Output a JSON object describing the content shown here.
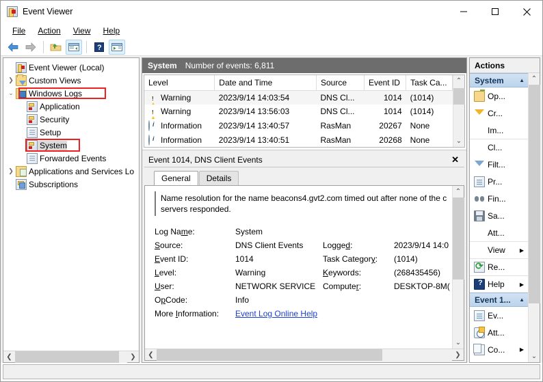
{
  "window": {
    "title": "Event Viewer",
    "icon": "event-viewer-icon",
    "minimize": "−",
    "maximize": "□",
    "close": "✕"
  },
  "menu": {
    "items": [
      {
        "label": "File",
        "accel": "F"
      },
      {
        "label": "Action",
        "accel": "A"
      },
      {
        "label": "View",
        "accel": "V"
      },
      {
        "label": "Help",
        "accel": "H"
      }
    ]
  },
  "toolbar": {
    "buttons": [
      {
        "name": "back-icon",
        "active": false
      },
      {
        "name": "forward-icon",
        "active": false
      },
      {
        "name": "show-hide-tree-icon",
        "active": false
      },
      {
        "name": "show-hide-console-tree-icon",
        "active": true
      },
      {
        "name": "help-icon",
        "active": false
      },
      {
        "name": "show-hide-action-pane-icon",
        "active": true
      }
    ]
  },
  "tree": {
    "nodes": [
      {
        "label": "Event Viewer (Local)",
        "icon": "event-viewer-icon",
        "indent": 0,
        "twist": "",
        "selected": false,
        "highlight": false
      },
      {
        "label": "Custom Views",
        "icon": "custom-views-folder-icon",
        "indent": 0,
        "twist": "collapsed",
        "selected": false,
        "highlight": false
      },
      {
        "label": "Windows Logs",
        "icon": "windows-logs-folder-icon",
        "indent": 0,
        "twist": "expanded",
        "selected": false,
        "highlight": true
      },
      {
        "label": "Application",
        "icon": "log-icon",
        "indent": 1,
        "twist": "",
        "selected": false,
        "highlight": false
      },
      {
        "label": "Security",
        "icon": "log-icon",
        "indent": 1,
        "twist": "",
        "selected": false,
        "highlight": false
      },
      {
        "label": "Setup",
        "icon": "plain-log-icon",
        "indent": 1,
        "twist": "",
        "selected": false,
        "highlight": false
      },
      {
        "label": "System",
        "icon": "log-icon",
        "indent": 1,
        "twist": "",
        "selected": true,
        "highlight": true
      },
      {
        "label": "Forwarded Events",
        "icon": "plain-log-icon",
        "indent": 1,
        "twist": "",
        "selected": false,
        "highlight": false
      },
      {
        "label": "Applications and Services Lo",
        "icon": "apps-services-folder-icon",
        "indent": 0,
        "twist": "collapsed",
        "selected": false,
        "highlight": false
      },
      {
        "label": "Subscriptions",
        "icon": "subscriptions-icon",
        "indent": 0,
        "twist": "",
        "selected": false,
        "highlight": false
      }
    ]
  },
  "center": {
    "header": {
      "log_name": "System",
      "count_text": "Number of events: 6,811"
    },
    "list": {
      "columns": [
        "Level",
        "Date and Time",
        "Source",
        "Event ID",
        "Task Ca..."
      ],
      "rows": [
        {
          "level": "Warning",
          "level_icon": "warning-icon",
          "datetime": "2023/9/14 14:03:54",
          "source": "DNS Cl...",
          "event_id": "1014",
          "task": "(1014)"
        },
        {
          "level": "Warning",
          "level_icon": "warning-icon",
          "datetime": "2023/9/14 13:56:03",
          "source": "DNS Cl...",
          "event_id": "1014",
          "task": "(1014)"
        },
        {
          "level": "Information",
          "level_icon": "information-icon",
          "datetime": "2023/9/14 13:40:57",
          "source": "RasMan",
          "event_id": "20267",
          "task": "None"
        },
        {
          "level": "Information",
          "level_icon": "information-icon",
          "datetime": "2023/9/14 13:40:51",
          "source": "RasMan",
          "event_id": "20268",
          "task": "None"
        }
      ]
    },
    "details": {
      "header": "Event 1014, DNS Client Events",
      "close_label": "✕",
      "tabs": [
        {
          "label": "General",
          "selected": true
        },
        {
          "label": "Details",
          "selected": false
        }
      ],
      "message": "Name resolution for the name beacons4.gvt2.com timed out after none of the c servers responded.",
      "fields": [
        {
          "label": "Log Name:",
          "accel": "m",
          "value": "System",
          "label2": "",
          "value2": ""
        },
        {
          "label": "Source:",
          "accel": "S",
          "value": "DNS Client Events",
          "label2": "Logged:",
          "accel2": "d",
          "value2": "2023/9/14 14:0"
        },
        {
          "label": "Event ID:",
          "accel": "E",
          "value": "1014",
          "label2": "Task Category:",
          "accel2": "y",
          "value2": "(1014)"
        },
        {
          "label": "Level:",
          "accel": "L",
          "value": "Warning",
          "label2": "Keywords:",
          "accel2": "K",
          "value2": "(268435456)"
        },
        {
          "label": "User:",
          "accel": "U",
          "value": "NETWORK SERVICE",
          "label2": "Computer:",
          "accel2": "r",
          "value2": "DESKTOP-8M("
        },
        {
          "label": "OpCode:",
          "accel": "p",
          "value": "Info",
          "label2": "",
          "value2": ""
        }
      ],
      "more_info_label": "More Information:",
      "more_info_accel": "I",
      "more_info_link": "Event Log Online Help"
    }
  },
  "actions": {
    "title": "Actions",
    "groups": [
      {
        "name": "System",
        "caret": "▲",
        "items": [
          {
            "label": "Op...",
            "icon": "open-saved-log-icon",
            "submenu": false,
            "divider": false
          },
          {
            "label": "Cr...",
            "icon": "create-custom-view-icon",
            "submenu": false,
            "divider": false
          },
          {
            "label": "Im...",
            "icon": "",
            "submenu": false,
            "divider": false
          },
          {
            "label": "Cl...",
            "icon": "",
            "submenu": false,
            "divider": true
          },
          {
            "label": "Filt...",
            "icon": "filter-icon",
            "submenu": false,
            "divider": false
          },
          {
            "label": "Pr...",
            "icon": "properties-icon",
            "submenu": false,
            "divider": false
          },
          {
            "label": "Fin...",
            "icon": "find-icon",
            "submenu": false,
            "divider": false
          },
          {
            "label": "Sa...",
            "icon": "save-icon",
            "submenu": false,
            "divider": false
          },
          {
            "label": "Att...",
            "icon": "",
            "submenu": false,
            "divider": false
          },
          {
            "label": "View",
            "icon": "",
            "submenu": true,
            "divider": true
          },
          {
            "label": "Re...",
            "icon": "refresh-icon",
            "submenu": false,
            "divider": true
          },
          {
            "label": "Help",
            "icon": "help-icon",
            "submenu": true,
            "divider": true
          }
        ]
      },
      {
        "name": "Event 1...",
        "caret": "▲",
        "items": [
          {
            "label": "Ev...",
            "icon": "event-properties-icon",
            "submenu": false,
            "divider": false
          },
          {
            "label": "Att...",
            "icon": "attach-task-icon",
            "submenu": false,
            "divider": false
          },
          {
            "label": "Co...",
            "icon": "copy-icon",
            "submenu": true,
            "divider": false
          }
        ]
      }
    ]
  },
  "scrollbars": {
    "up_arrow": "⌃",
    "down_arrow": "⌄",
    "left_arrow": "❮",
    "right_arrow": "❯"
  },
  "colors": {
    "header_bar": "#6d6d6d",
    "highlight_red": "#ef2020",
    "link_blue": "#1b3fd4",
    "group_blue": "#bcd4ec",
    "warning_yellow": "#f2c200"
  }
}
